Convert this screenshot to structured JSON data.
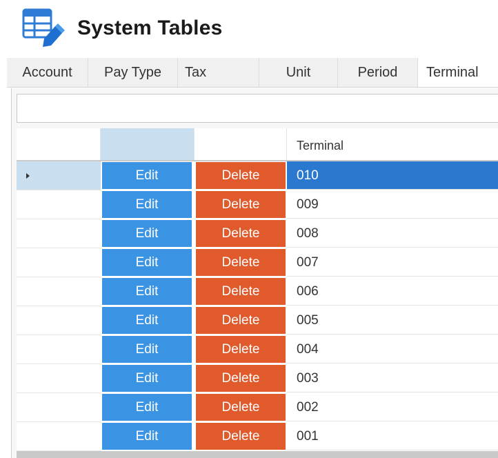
{
  "header": {
    "title": "System Tables",
    "icon": "table-edit-icon"
  },
  "tabs": [
    {
      "label": "Account"
    },
    {
      "label": "Pay Type"
    },
    {
      "label": "Tax"
    },
    {
      "label": "Unit"
    },
    {
      "label": "Period"
    },
    {
      "label": "Terminal",
      "active": true
    }
  ],
  "grid": {
    "column_header": "Terminal",
    "edit_label": "Edit",
    "delete_label": "Delete",
    "rows": [
      {
        "value": "010",
        "selected": true
      },
      {
        "value": "009"
      },
      {
        "value": "008"
      },
      {
        "value": "007"
      },
      {
        "value": "006"
      },
      {
        "value": "005"
      },
      {
        "value": "004"
      },
      {
        "value": "003"
      },
      {
        "value": "002"
      },
      {
        "value": "001"
      }
    ]
  },
  "colors": {
    "edit_button": "#3a93e3",
    "delete_button": "#e05a2b",
    "selected_cell": "#2a78d0"
  }
}
